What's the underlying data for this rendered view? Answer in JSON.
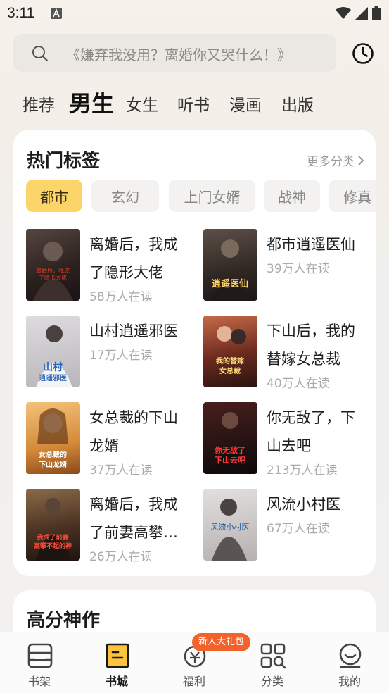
{
  "status_bar": {
    "time": "3:11"
  },
  "search": {
    "placeholder": "《嫌弃我没用？离婚你又哭什么！》"
  },
  "top_tabs": [
    "推荐",
    "男生",
    "女生",
    "听书",
    "漫画",
    "出版"
  ],
  "active_tab": "男生",
  "hot_tags": {
    "title": "热门标签",
    "more": "更多分类",
    "chips": [
      "都市",
      "玄幻",
      "上门女婿",
      "战神",
      "修真"
    ],
    "active_chip": "都市",
    "books": [
      {
        "title": "离婚后，我成了隐形大佬",
        "readers": "58万人在读",
        "cover_text": "离婚后，我成了隐形大佬",
        "cover_bg": "#3a2e2c"
      },
      {
        "title": "都市逍遥医仙",
        "readers": "39万人在读",
        "cover_text": "逍遥医仙",
        "cover_bg": "#2f2a26"
      },
      {
        "title": "山村逍遥邪医",
        "readers": "17万人在读",
        "cover_text": "山村逍遥邪医",
        "cover_bg": "#c9c6c9"
      },
      {
        "title": "下山后，我的替嫁女总裁",
        "readers": "40万人在读",
        "cover_text": "我的替嫁女总裁",
        "cover_bg": "#6b2a1e"
      },
      {
        "title": "女总裁的下山龙婿",
        "readers": "37万人在读",
        "cover_text": "女总裁的下山龙婿",
        "cover_bg": "#d49b4a"
      },
      {
        "title": "你无敌了，下山去吧",
        "readers": "213万人在读",
        "cover_text": "你无敌了下山去吧",
        "cover_bg": "#2a1a1a"
      },
      {
        "title": "离婚后，我成了前妻高攀不起的神",
        "readers": "26万人在读",
        "cover_text": "我成了前妻高攀不起的神",
        "cover_bg": "#5a3a22"
      },
      {
        "title": "风流小村医",
        "readers": "67万人在读",
        "cover_text": "风流小村医",
        "cover_bg": "#c7c3c2"
      }
    ]
  },
  "second_section": {
    "title": "高分神作"
  },
  "bottom_nav": {
    "items": [
      "书架",
      "书城",
      "福利",
      "分类",
      "我的"
    ],
    "active": "书城",
    "badge": "新人大礼包"
  },
  "colors": {
    "accent_yellow": "#fbd56a",
    "badge_orange": "#f2622a"
  }
}
